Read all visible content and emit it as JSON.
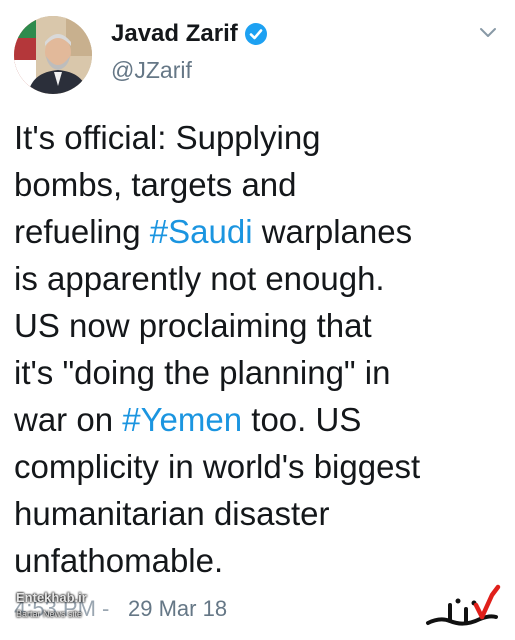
{
  "user": {
    "display_name": "Javad Zarif",
    "handle": "@JZarif",
    "verified_icon": "verified-badge-icon",
    "avatar": "profile-photo"
  },
  "tweet": {
    "lines": [
      [
        {
          "text": "It's official: Supplying"
        }
      ],
      [
        {
          "text": "bombs, targets and"
        }
      ],
      [
        {
          "text": "refueling "
        },
        {
          "text": "#Saudi",
          "hashtag": true
        },
        {
          "text": " warplanes"
        }
      ],
      [
        {
          "text": "is apparently not enough."
        }
      ],
      [
        {
          "text": "US now proclaiming that"
        }
      ],
      [
        {
          "text": "it's \"doing the planning\" in"
        }
      ],
      [
        {
          "text": "war on "
        },
        {
          "text": "#Yemen",
          "hashtag": true
        },
        {
          "text": " too. US"
        }
      ],
      [
        {
          "text": "complicity in world's biggest"
        }
      ],
      [
        {
          "text": "humanitarian disaster"
        }
      ],
      [
        {
          "text": "unfathomable."
        }
      ]
    ],
    "timestamp": "29 Mar 18",
    "timestamp_obscured": "4:53 PM -"
  },
  "watermarks": {
    "left_title": "Entekhab.ir",
    "left_sub": "Bartar News site"
  },
  "colors": {
    "hashtag": "#1b95e0",
    "secondary_text": "#657786",
    "verified": "#1da1f2"
  },
  "icons": {
    "caret": "chevron-down-icon"
  }
}
